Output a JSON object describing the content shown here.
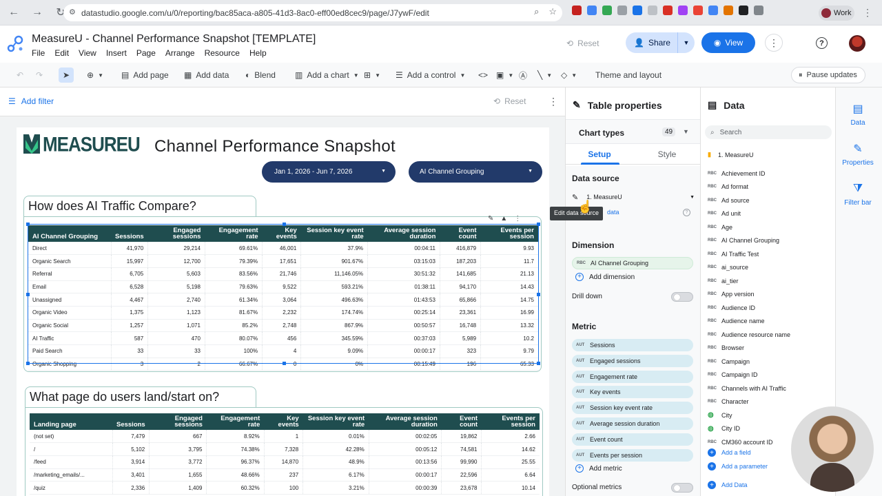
{
  "browser": {
    "url": "datastudio.google.com/u/0/reporting/bac85aca-a805-41d3-8ac0-eff00ed8cec9/page/J7ywF/edit",
    "profile": "Work"
  },
  "header": {
    "title": "MeasureU - Channel Performance Snapshot [TEMPLATE]",
    "menu": [
      "File",
      "Edit",
      "View",
      "Insert",
      "Page",
      "Arrange",
      "Resource",
      "Help"
    ],
    "reset": "Reset",
    "share": "Share",
    "view": "View"
  },
  "toolbar": {
    "add_page": "Add page",
    "add_data": "Add data",
    "blend": "Blend",
    "add_chart": "Add a chart",
    "add_control": "Add a control",
    "theme": "Theme and layout",
    "pause": "Pause updates"
  },
  "canvas": {
    "add_filter": "Add filter",
    "reset": "Reset",
    "logo_text": "MEASUREU",
    "report_title": "Channel Performance Snapshot",
    "date_range": "Jan 1, 2026 - Jun 7, 2026",
    "grouping": "AI Channel Grouping"
  },
  "table1": {
    "heading": "How does AI Traffic Compare?",
    "columns": [
      "AI Channel Grouping",
      "Sessions",
      "Engaged sessions",
      "Engagement rate",
      "Key events",
      "Session key event rate",
      "Average session duration",
      "Event count",
      "Events per session"
    ],
    "rows": [
      [
        "Direct",
        "41,970",
        "29,214",
        "69.61%",
        "46,001",
        "37.9%",
        "00:04:11",
        "416,879",
        "9.93"
      ],
      [
        "Organic Search",
        "15,997",
        "12,700",
        "79.39%",
        "17,651",
        "901.67%",
        "03:15:03",
        "187,203",
        "11.7"
      ],
      [
        "Referral",
        "6,705",
        "5,603",
        "83.56%",
        "21,746",
        "11,146.05%",
        "30:51:32",
        "141,685",
        "21.13"
      ],
      [
        "Email",
        "6,528",
        "5,198",
        "79.63%",
        "9,522",
        "593.21%",
        "01:38:11",
        "94,170",
        "14.43"
      ],
      [
        "Unassigned",
        "4,467",
        "2,740",
        "61.34%",
        "3,064",
        "496.63%",
        "01:43:53",
        "65,866",
        "14.75"
      ],
      [
        "Organic Video",
        "1,375",
        "1,123",
        "81.67%",
        "2,232",
        "174.74%",
        "00:25:14",
        "23,361",
        "16.99"
      ],
      [
        "Organic Social",
        "1,257",
        "1,071",
        "85.2%",
        "2,748",
        "867.9%",
        "00:50:57",
        "16,748",
        "13.32"
      ],
      [
        "AI Traffic",
        "587",
        "470",
        "80.07%",
        "456",
        "345.59%",
        "00:37:03",
        "5,989",
        "10.2"
      ],
      [
        "Paid Search",
        "33",
        "33",
        "100%",
        "4",
        "9.09%",
        "00:00:17",
        "323",
        "9.79"
      ],
      [
        "Organic Shopping",
        "3",
        "2",
        "66.67%",
        "0",
        "0%",
        "00:15:49",
        "196",
        "65.33"
      ]
    ]
  },
  "table2": {
    "heading": "What page do users land/start on?",
    "columns": [
      "Landing page",
      "Sessions",
      "Engaged sessions",
      "Engagement rate",
      "Key events",
      "Session key event rate",
      "Average session duration",
      "Event count",
      "Events per session"
    ],
    "rows": [
      [
        "(not set)",
        "7,479",
        "667",
        "8.92%",
        "1",
        "0.01%",
        "00:02:05",
        "19,862",
        "2.66"
      ],
      [
        "/",
        "5,102",
        "3,795",
        "74.38%",
        "7,328",
        "42.28%",
        "00:05:12",
        "74,581",
        "14.62"
      ],
      [
        "/feed",
        "3,914",
        "3,772",
        "96.37%",
        "14,870",
        "48.9%",
        "00:13:56",
        "99,990",
        "25.55"
      ],
      [
        "/marketing_emails/...",
        "3,401",
        "1,655",
        "48.66%",
        "237",
        "6.17%",
        "00:00:17",
        "22,596",
        "6.64"
      ],
      [
        "/quiz",
        "2,336",
        "1,409",
        "60.32%",
        "100",
        "3.21%",
        "00:00:39",
        "23,678",
        "10.14"
      ]
    ]
  },
  "properties": {
    "title": "Table properties",
    "chart_types": "Chart types",
    "chart_types_count": "49",
    "tab_setup": "Setup",
    "tab_style": "Style",
    "data_source_label": "Data source",
    "data_source": "1. MeasureU",
    "tooltip": "Edit data source",
    "add_data_link": "data",
    "dimension_label": "Dimension",
    "dimension": "AI Channel Grouping",
    "add_dimension": "Add dimension",
    "drill_down": "Drill down",
    "metric_label": "Metric",
    "metrics": [
      "Sessions",
      "Engaged sessions",
      "Engagement rate",
      "Key events",
      "Session key event rate",
      "Average session duration",
      "Event count",
      "Events per session"
    ],
    "add_metric": "Add metric",
    "optional_metrics": "Optional metrics"
  },
  "data_panel": {
    "title": "Data",
    "search_placeholder": "Search",
    "source": "1. MeasureU",
    "fields": [
      "Achievement ID",
      "Ad format",
      "Ad source",
      "Ad unit",
      "Age",
      "AI Channel Grouping",
      "AI Traffic Test",
      "ai_source",
      "ai_tier",
      "App version",
      "Audience ID",
      "Audience name",
      "Audience resource name",
      "Browser",
      "Campaign",
      "Campaign ID",
      "Channels with AI Traffic",
      "Character",
      "City",
      "City ID",
      "CM360 account ID"
    ],
    "add_field": "Add a field",
    "add_parameter": "Add a parameter",
    "add_data": "Add Data"
  },
  "rail": {
    "data": "Data",
    "properties": "Properties",
    "filter_bar": "Filter bar"
  }
}
